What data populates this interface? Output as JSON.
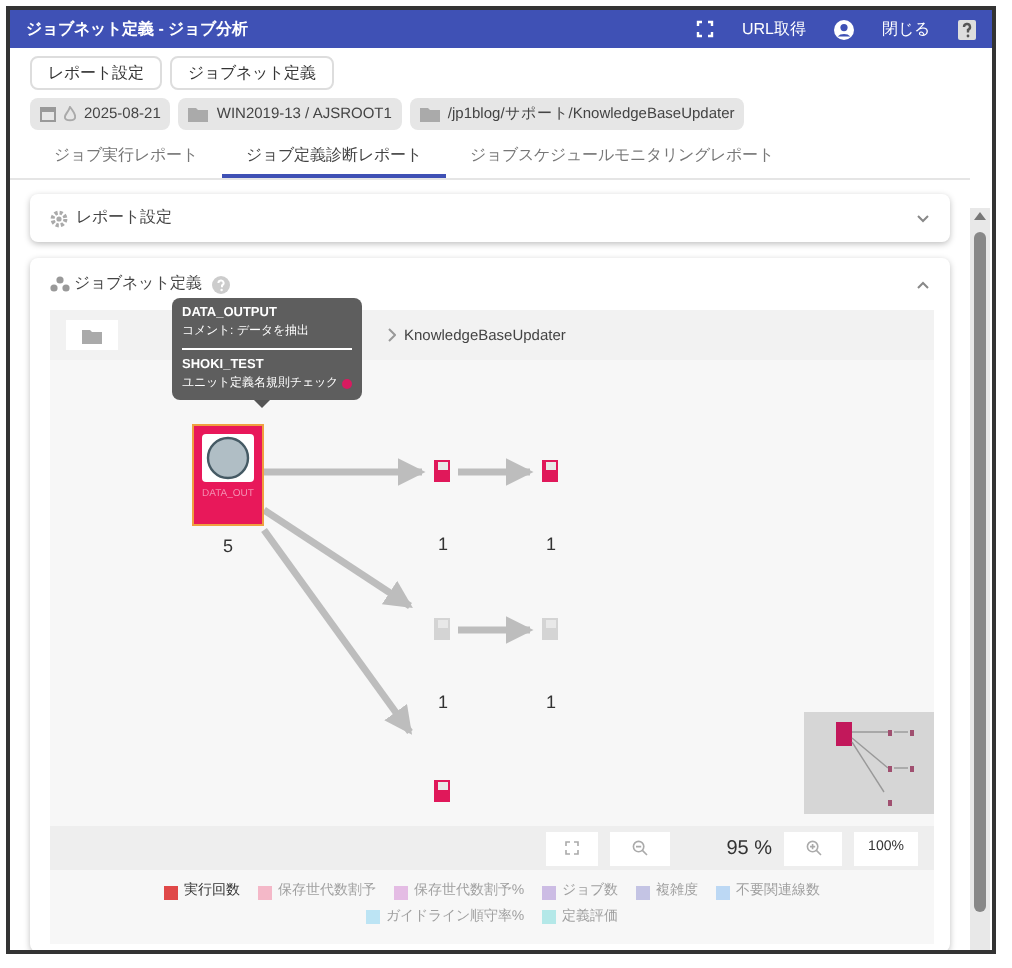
{
  "window": {
    "title": "ジョブネット定義 - ジョブ分析"
  },
  "header_actions": [
    {
      "kind": "fullscreen"
    },
    {
      "kind": "text",
      "label": "URL取得"
    },
    {
      "kind": "account"
    },
    {
      "kind": "text",
      "label": "閉じる"
    },
    {
      "kind": "help"
    }
  ],
  "toolbar_buttons": [
    "レポート設定",
    "ジョブネット定義"
  ],
  "chips": [
    {
      "kind": "date",
      "label": "2025-08-21"
    },
    {
      "kind": "folder",
      "label": "WIN2019-13 / AJSROOT1"
    },
    {
      "kind": "folder",
      "label": "/jp1blog/サポート/KnowledgeBaseUpdater"
    }
  ],
  "tabs": [
    {
      "label": "ジョブ実行レポート",
      "selected": false
    },
    {
      "label": "ジョブ定義診断レポート",
      "selected": true
    },
    {
      "label": "ジョブスケジュールモニタリングレポート",
      "selected": false
    }
  ],
  "sections": [
    {
      "kind": "settings",
      "title": "レポート設定",
      "expanded": false
    },
    {
      "kind": "jobnet",
      "title": "ジョブネット定義",
      "expanded": true
    }
  ],
  "breadcrumb": [
    "KnowledgeBaseUpdater"
  ],
  "tooltip": [
    {
      "name": "DATA_OUTPUT",
      "comment": "コメント: データを抽出"
    },
    {
      "name": "SHOKI_TEST",
      "comment": "ユニット定義名規則チェック"
    }
  ],
  "graph": {
    "nodes": [
      {
        "kind": "main",
        "label": "DATA_OUT",
        "count": "5",
        "color": "#e8185a"
      },
      {
        "kind": "job",
        "count": "1",
        "color": "#e0185a"
      },
      {
        "kind": "job",
        "count": "1",
        "color": "#e0185a"
      },
      {
        "kind": "job",
        "count": "1",
        "color": "#d4d4d4"
      },
      {
        "kind": "job",
        "count": "1",
        "color": "#d4d4d4"
      },
      {
        "kind": "job",
        "color": "#e0185a"
      }
    ]
  },
  "zoom": {
    "reading": "95 %",
    "reset": "100%"
  },
  "legend": [
    {
      "label": "実行回数",
      "color": "#e04848",
      "selected": true
    },
    {
      "label": "保存世代数割予",
      "color": "#f4b8c8",
      "selected": false
    },
    {
      "label": "保存世代数割予%",
      "color": "#e4bce4",
      "selected": false
    },
    {
      "label": "ジョブ数",
      "color": "#ccbce4",
      "selected": false
    },
    {
      "label": "複雑度",
      "color": "#c4c4e4",
      "selected": false
    },
    {
      "label": "不要関連線数",
      "color": "#bcd8f4",
      "selected": false
    },
    {
      "label": "ガイドライン順守率%",
      "color": "#bce4f4",
      "selected": false
    },
    {
      "label": "定義評価",
      "color": "#b4e8e8",
      "selected": false
    }
  ]
}
